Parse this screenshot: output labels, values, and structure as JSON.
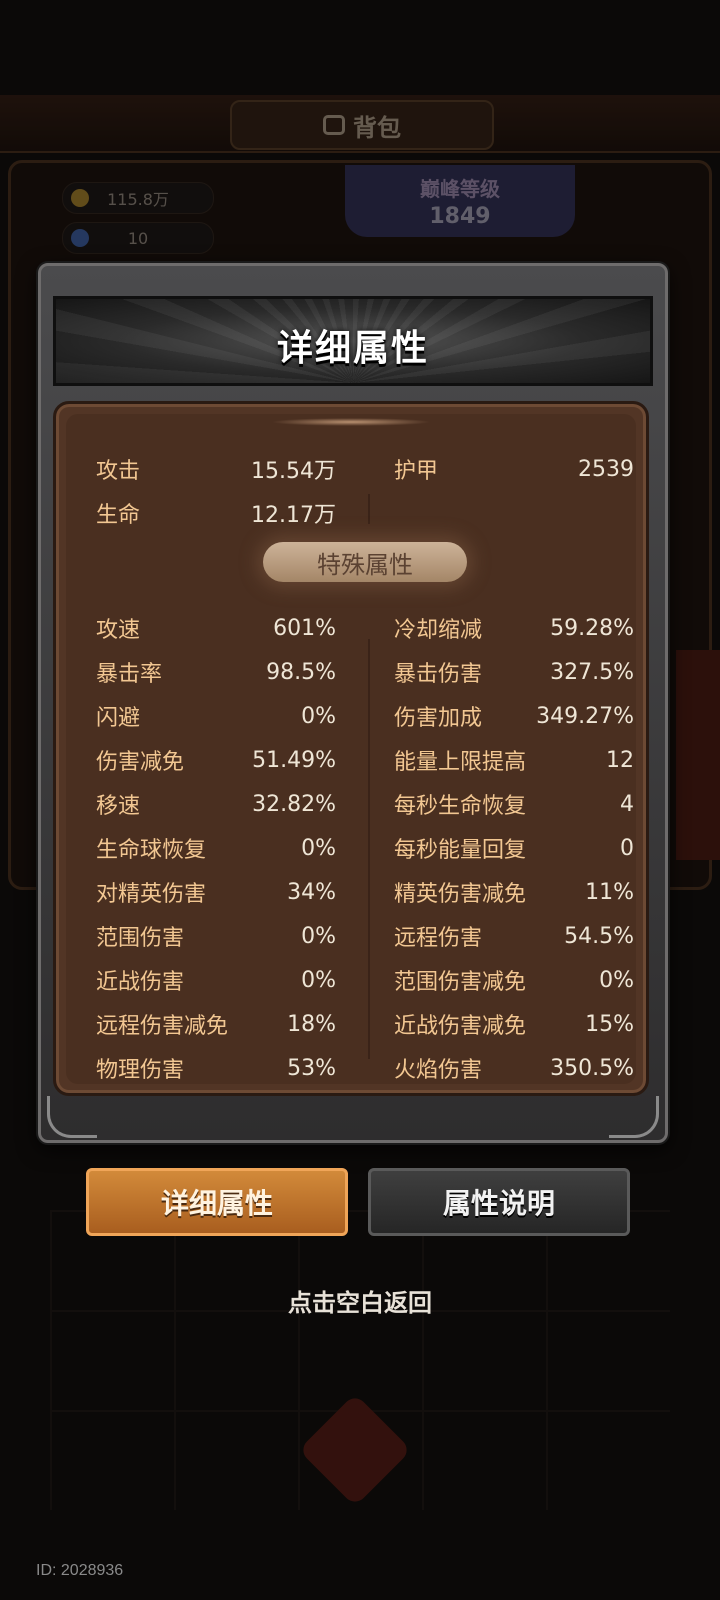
{
  "background": {
    "bag_title": "背包",
    "gold": "115.8万",
    "gems": "10",
    "level_label": "巅峰等级",
    "level_value": "1849"
  },
  "panel": {
    "title": "详细属性",
    "section_label": "特殊属性"
  },
  "base_stats": {
    "left": [
      {
        "label": "攻击",
        "value": "15.54万"
      },
      {
        "label": "生命",
        "value": "12.17万"
      }
    ],
    "right": [
      {
        "label": "护甲",
        "value": "2539"
      }
    ]
  },
  "special_stats": {
    "left": [
      {
        "label": "攻速",
        "value": "601%"
      },
      {
        "label": "暴击率",
        "value": "98.5%"
      },
      {
        "label": "闪避",
        "value": "0%"
      },
      {
        "label": "伤害减免",
        "value": "51.49%"
      },
      {
        "label": "移速",
        "value": "32.82%"
      },
      {
        "label": "生命球恢复",
        "value": "0%"
      },
      {
        "label": "对精英伤害",
        "value": "34%"
      },
      {
        "label": "范围伤害",
        "value": "0%"
      },
      {
        "label": "近战伤害",
        "value": "0%"
      },
      {
        "label": "远程伤害减免",
        "value": "18%"
      },
      {
        "label": "物理伤害",
        "value": "53%"
      }
    ],
    "right": [
      {
        "label": "冷却缩减",
        "value": "59.28%"
      },
      {
        "label": "暴击伤害",
        "value": "327.5%"
      },
      {
        "label": "伤害加成",
        "value": "349.27%"
      },
      {
        "label": "能量上限提高",
        "value": "12"
      },
      {
        "label": "每秒生命恢复",
        "value": "4"
      },
      {
        "label": "每秒能量回复",
        "value": "0"
      },
      {
        "label": "精英伤害减免",
        "value": "11%"
      },
      {
        "label": "远程伤害",
        "value": "54.5%"
      },
      {
        "label": "范围伤害减免",
        "value": "0%"
      },
      {
        "label": "近战伤害减免",
        "value": "15%"
      },
      {
        "label": "火焰伤害",
        "value": "350.5%"
      }
    ]
  },
  "tabs": {
    "detail_label": "详细属性",
    "description_label": "属性说明"
  },
  "hint": "点击空白返回",
  "user_id": "ID: 2028936",
  "colors": {
    "label": "#f2c792",
    "value": "#efe6d6",
    "active_tab": "#c27a30",
    "panel_brown": "#4a2f20"
  }
}
